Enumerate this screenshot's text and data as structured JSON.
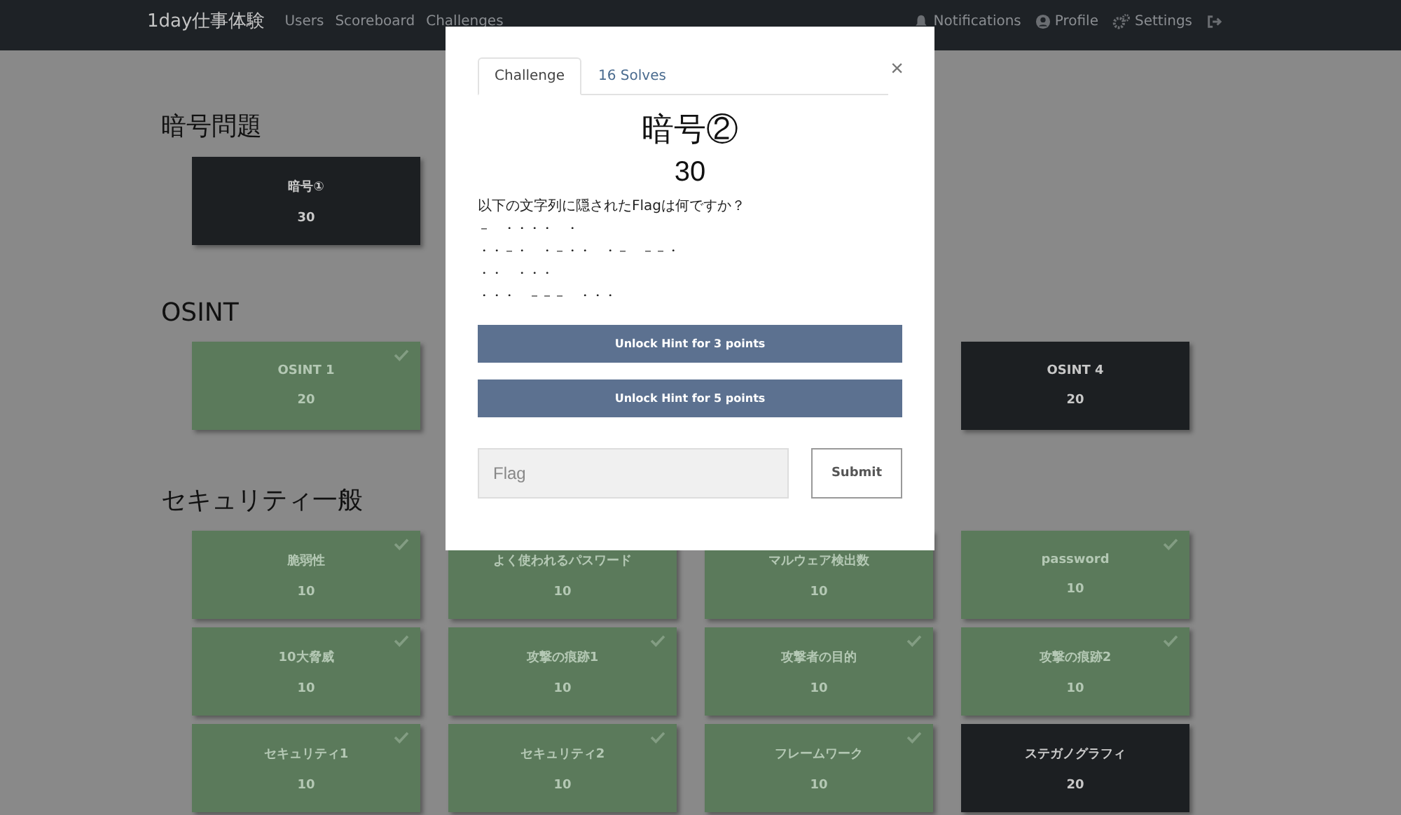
{
  "navbar": {
    "brand": "1day仕事体験",
    "links": [
      {
        "label": "Users"
      },
      {
        "label": "Scoreboard"
      },
      {
        "label": "Challenges"
      }
    ],
    "right_links": [
      {
        "kind": "bell",
        "label": "Notifications"
      },
      {
        "kind": "user",
        "label": "Profile"
      },
      {
        "kind": "gears",
        "label": "Settings"
      },
      {
        "kind": "logout"
      }
    ]
  },
  "categories": [
    {
      "title": "暗号問題",
      "cards": [
        {
          "kind": "card",
          "name": "暗号①",
          "value": "30",
          "solved": false
        }
      ]
    },
    {
      "title": "OSINT",
      "cards": [
        {
          "kind": "card",
          "name": "OSINT 1",
          "value": "20",
          "solved": true
        },
        {
          "kind": "covered"
        },
        {
          "kind": "covered"
        },
        {
          "kind": "card",
          "name": "OSINT 4",
          "value": "20",
          "solved": false
        }
      ]
    },
    {
      "title": "セキュリティ一般",
      "cards": [
        {
          "kind": "card",
          "name": "脆弱性",
          "value": "10",
          "solved": true
        },
        {
          "kind": "card",
          "name": "よく使われるパスワード",
          "value": "10",
          "solved": true
        },
        {
          "kind": "card",
          "name": "マルウェア検出数",
          "value": "10",
          "solved": true
        },
        {
          "kind": "card",
          "name": "password",
          "value": "10",
          "solved": true
        },
        {
          "kind": "card",
          "name": "10大脅威",
          "value": "10",
          "solved": true
        },
        {
          "kind": "card",
          "name": "攻撃の痕跡1",
          "value": "10",
          "solved": true
        },
        {
          "kind": "card",
          "name": "攻撃者の目的",
          "value": "10",
          "solved": true
        },
        {
          "kind": "card",
          "name": "攻撃の痕跡2",
          "value": "10",
          "solved": true
        },
        {
          "kind": "card",
          "name": "セキュリティ1",
          "value": "10",
          "solved": true
        },
        {
          "kind": "card",
          "name": "セキュリティ2",
          "value": "10",
          "solved": true
        },
        {
          "kind": "card",
          "name": "フレームワーク",
          "value": "10",
          "solved": true
        },
        {
          "kind": "card",
          "name": "ステガノグラフィ",
          "value": "20",
          "solved": false
        }
      ]
    }
  ],
  "modal": {
    "tabs": [
      {
        "label": "Challenge",
        "selected": true
      },
      {
        "label": "16 Solves",
        "selected": false
      }
    ],
    "close": "×",
    "title": "暗号②",
    "value": "30",
    "description": "以下の文字列に隠されたFlagは何ですか？",
    "code_lines": [
      "－　・・・・　・",
      "・・－・　・－・・　・－　－－・",
      "・・　・・・",
      "・・・　－－－　・・・"
    ],
    "hints": [
      {
        "label": "Unlock Hint for 3 points"
      },
      {
        "label": "Unlock Hint for 5 points"
      }
    ],
    "flag": {
      "placeholder": "Flag"
    },
    "submit": "Submit"
  }
}
